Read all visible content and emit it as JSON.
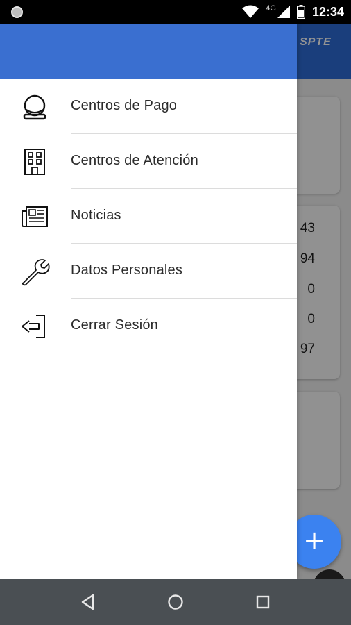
{
  "status_bar": {
    "time": "12:34",
    "network": "4G",
    "icons": [
      "notification-dot-icon",
      "wifi-icon",
      "signal-icon",
      "battery-icon"
    ]
  },
  "app": {
    "logo_text": "SPTE",
    "card_numbers": [
      "43",
      "94",
      "0",
      "0",
      "97"
    ],
    "accent_color": "#3b82f0",
    "header_color": "#2d6cd6"
  },
  "drawer": {
    "header_color": "#3a6fd0",
    "items": [
      {
        "label": "Centros de Pago",
        "icon": "payment-center-icon"
      },
      {
        "label": "Centros de Atención",
        "icon": "building-icon"
      },
      {
        "label": "Noticias",
        "icon": "newspaper-icon"
      },
      {
        "label": "Datos Personales",
        "icon": "wrench-icon"
      },
      {
        "label": "Cerrar Sesión",
        "icon": "logout-icon"
      }
    ]
  },
  "fab": {
    "label": "+"
  },
  "nav_bar": {
    "buttons": [
      "back-icon",
      "home-icon",
      "recents-icon"
    ]
  }
}
